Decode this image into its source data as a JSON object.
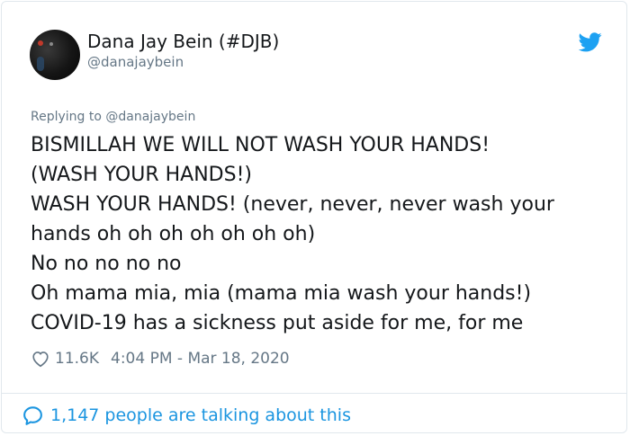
{
  "tweet": {
    "author": {
      "display_name": "Dana Jay Bein (#DJB)",
      "handle": "@danajaybein"
    },
    "replying_to": "Replying to @danajaybein",
    "text_lines": [
      "BISMILLAH WE WILL NOT WASH YOUR HANDS!",
      "(WASH YOUR HANDS!)",
      "WASH YOUR HANDS! (never, never, never wash your",
      "hands oh oh oh oh oh oh oh)",
      "No no no no no",
      "Oh mama mia, mia (mama mia wash your hands!)",
      "COVID-19 has a sickness put aside for me, for me"
    ],
    "likes": "11.6K",
    "timestamp": "4:04 PM - Mar 18, 2020",
    "talking": "1,147 people are talking about this"
  },
  "icons": {
    "brand": "twitter-bird-icon",
    "like": "heart-icon",
    "conversation": "speech-bubble-icon"
  },
  "colors": {
    "twitter_blue": "#1da1f2",
    "link_blue": "#1b95e0",
    "secondary_text": "#657786",
    "primary_text": "#14171a",
    "border": "#e1e8ed"
  }
}
